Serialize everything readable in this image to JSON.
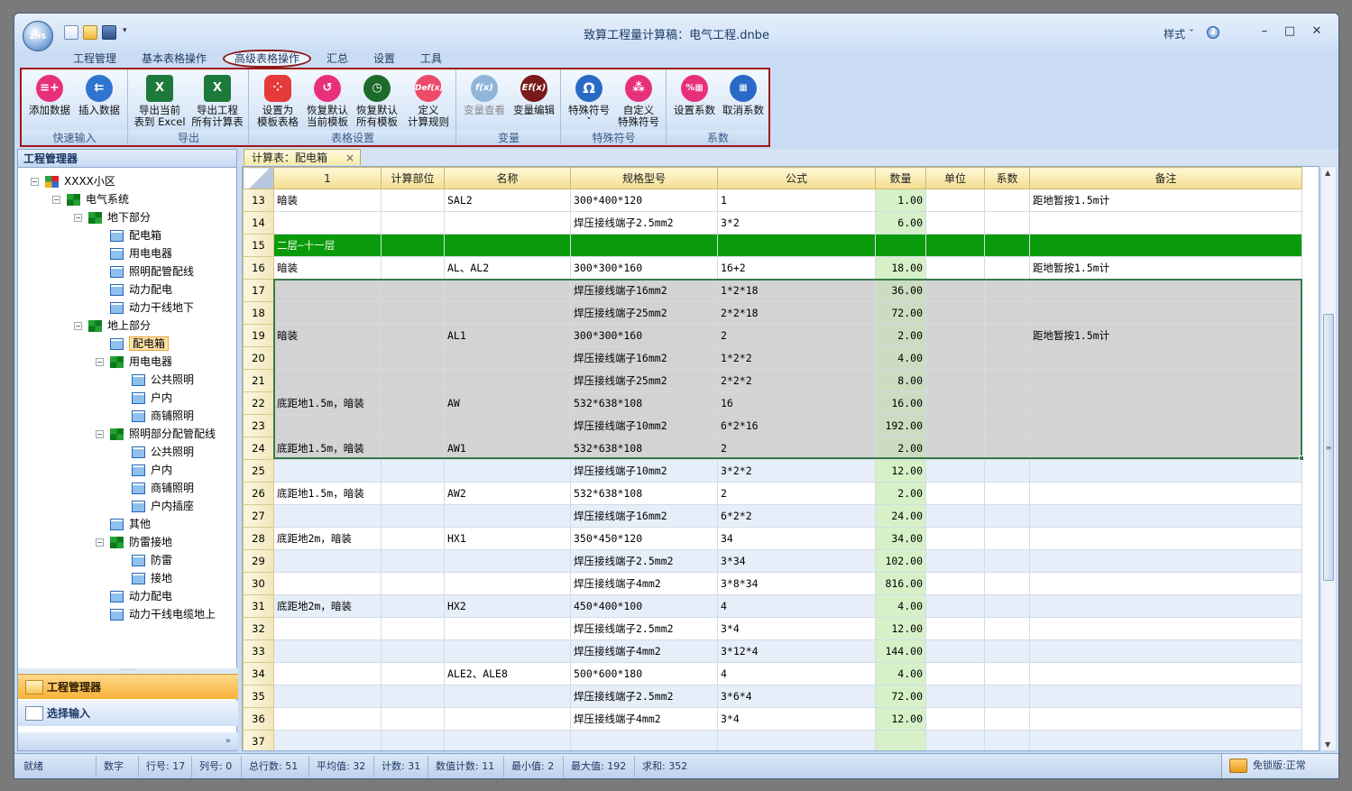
{
  "window": {
    "logo_text": "ZHS",
    "title": "致算工程量计算稿：电气工程.dnbe",
    "style_menu": "样式 ˇ",
    "help_icon": "help-icon",
    "min_glyph": "–",
    "max_glyph": "□",
    "close_glyph": "✕"
  },
  "tabs": [
    "工程管理",
    "基本表格操作",
    "高级表格操作",
    "汇总",
    "设置",
    "工具"
  ],
  "active_tab": "高级表格操作",
  "ribbon": {
    "groups": [
      {
        "label": "快速输入",
        "buttons": [
          {
            "label": "添加数据",
            "icon": "add-data-icon",
            "color": "#e8307a"
          },
          {
            "label": "插入数据",
            "icon": "insert-data-icon",
            "color": "#2f74d0"
          }
        ]
      },
      {
        "label": "导出",
        "buttons": [
          {
            "label": "导出当前\n表到 Excel",
            "icon": "excel-icon",
            "color": "#1d7a3a"
          },
          {
            "label": "导出工程\n所有计算表",
            "icon": "excel-icon",
            "color": "#1d7a3a"
          }
        ]
      },
      {
        "label": "表格设置",
        "buttons": [
          {
            "label": "设置为\n模板表格",
            "icon": "template-icon",
            "color": "#e63a3a"
          },
          {
            "label": "恢复默认\n当前模板",
            "icon": "restore-icon",
            "color": "#e8307a"
          },
          {
            "label": "恢复默认\n所有模板",
            "icon": "restore-all-icon",
            "color": "#1d6a2a"
          },
          {
            "label": "定义\n计算规则",
            "icon": "def-fx-icon",
            "color": "#ee4a6a"
          }
        ]
      },
      {
        "label": "变量",
        "buttons": [
          {
            "label": "变量查看",
            "icon": "fx-view-icon",
            "color": "#8fb6d8",
            "disabled": true
          },
          {
            "label": "变量编辑",
            "icon": "efx-edit-icon",
            "color": "#7a1a1a"
          }
        ]
      },
      {
        "label": "特殊符号",
        "buttons": [
          {
            "label": "特殊符号\nˇ",
            "icon": "omega-icon",
            "color": "#2a6ac6"
          },
          {
            "label": "自定义\n特殊符号",
            "icon": "custom-symbol-icon",
            "color": "#e8307a"
          }
        ]
      },
      {
        "label": "系数",
        "buttons": [
          {
            "label": "设置系数",
            "icon": "coef-set-icon",
            "color": "#e8307a"
          },
          {
            "label": "取消系数",
            "icon": "coef-cancel-icon",
            "color": "#2a6ac6"
          }
        ]
      }
    ]
  },
  "left_panel": {
    "header": "工程管理器",
    "tree": [
      {
        "label": "XXXX小区",
        "level": 0,
        "icon": "project-icon",
        "expand": "−"
      },
      {
        "label": "电气系统",
        "level": 1,
        "icon": "folder-green-icon",
        "expand": "−"
      },
      {
        "label": "地下部分",
        "level": 2,
        "icon": "folder-green-icon",
        "expand": "−"
      },
      {
        "label": "配电箱",
        "level": 3,
        "icon": "table-icon"
      },
      {
        "label": "用电电器",
        "level": 3,
        "icon": "table-icon"
      },
      {
        "label": "照明配管配线",
        "level": 3,
        "icon": "table-icon"
      },
      {
        "label": "动力配电",
        "level": 3,
        "icon": "table-icon"
      },
      {
        "label": "动力干线地下",
        "level": 3,
        "icon": "table-icon"
      },
      {
        "label": "地上部分",
        "level": 2,
        "icon": "folder-green-icon",
        "expand": "−"
      },
      {
        "label": "配电箱",
        "level": 3,
        "icon": "table-icon",
        "selected": true
      },
      {
        "label": "用电电器",
        "level": 3,
        "icon": "folder-green-icon",
        "expand": "−"
      },
      {
        "label": "公共照明",
        "level": 4,
        "icon": "table-icon"
      },
      {
        "label": "户内",
        "level": 4,
        "icon": "table-icon"
      },
      {
        "label": "商铺照明",
        "level": 4,
        "icon": "table-icon"
      },
      {
        "label": "照明部分配管配线",
        "level": 3,
        "icon": "folder-green-icon",
        "expand": "−"
      },
      {
        "label": "公共照明",
        "level": 4,
        "icon": "table-icon"
      },
      {
        "label": "户内",
        "level": 4,
        "icon": "table-icon"
      },
      {
        "label": "商铺照明",
        "level": 4,
        "icon": "table-icon"
      },
      {
        "label": "户内插座",
        "level": 4,
        "icon": "table-icon"
      },
      {
        "label": "其他",
        "level": 3,
        "icon": "table-icon"
      },
      {
        "label": "防雷接地",
        "level": 3,
        "icon": "folder-green-icon",
        "expand": "−"
      },
      {
        "label": "防雷",
        "level": 4,
        "icon": "table-icon"
      },
      {
        "label": "接地",
        "level": 4,
        "icon": "table-icon"
      },
      {
        "label": "动力配电",
        "level": 3,
        "icon": "table-icon"
      },
      {
        "label": "动力干线电缆地上",
        "level": 3,
        "icon": "table-icon"
      }
    ],
    "nav_items": [
      {
        "label": "工程管理器",
        "active": true
      },
      {
        "label": "选择输入",
        "active": false
      }
    ],
    "footer_glyph": "»"
  },
  "doc_tab": {
    "label": "计算表：配电箱",
    "close": "×"
  },
  "grid": {
    "columns": [
      "",
      "1",
      "计算部位",
      "名称",
      "规格型号",
      "公式",
      "数量",
      "单位",
      "系数",
      "备注"
    ],
    "rows": [
      {
        "n": "13",
        "c1": "暗装",
        "part": "",
        "name": "SAL2",
        "spec": "300*400*120",
        "formula": "1",
        "qty": "1.00",
        "unit": "",
        "coef": "",
        "note": "距地暂按1.5m计"
      },
      {
        "n": "14",
        "c1": "",
        "part": "",
        "name": "",
        "spec": "焊压接线端子2.5mm2",
        "formula": "3*2",
        "qty": "6.00",
        "unit": "",
        "coef": "",
        "note": ""
      },
      {
        "n": "15",
        "c1": "二层~十一层",
        "part": "",
        "name": "",
        "spec": "",
        "formula": "",
        "qty": "",
        "unit": "",
        "coef": "",
        "note": "",
        "style": "hl"
      },
      {
        "n": "16",
        "c1": "暗装",
        "part": "",
        "name": "AL、AL2",
        "spec": "300*300*160",
        "formula": "16+2",
        "qty": "18.00",
        "unit": "",
        "coef": "",
        "note": "距地暂按1.5m计"
      },
      {
        "n": "17",
        "c1": "",
        "part": "",
        "name": "",
        "spec": "焊压接线端子16mm2",
        "formula": "1*2*18",
        "qty": "36.00",
        "unit": "",
        "coef": "",
        "note": "",
        "style": "sel"
      },
      {
        "n": "18",
        "c1": "",
        "part": "",
        "name": "",
        "spec": "焊压接线端子25mm2",
        "formula": "2*2*18",
        "qty": "72.00",
        "unit": "",
        "coef": "",
        "note": "",
        "style": "sel"
      },
      {
        "n": "19",
        "c1": "暗装",
        "part": "",
        "name": "AL1",
        "spec": "300*300*160",
        "formula": "2",
        "qty": "2.00",
        "unit": "",
        "coef": "",
        "note": "距地暂按1.5m计",
        "style": "sel"
      },
      {
        "n": "20",
        "c1": "",
        "part": "",
        "name": "",
        "spec": "焊压接线端子16mm2",
        "formula": "1*2*2",
        "qty": "4.00",
        "unit": "",
        "coef": "",
        "note": "",
        "style": "sel"
      },
      {
        "n": "21",
        "c1": "",
        "part": "",
        "name": "",
        "spec": "焊压接线端子25mm2",
        "formula": "2*2*2",
        "qty": "8.00",
        "unit": "",
        "coef": "",
        "note": "",
        "style": "sel"
      },
      {
        "n": "22",
        "c1": "底距地1.5m，暗装",
        "part": "",
        "name": "AW",
        "spec": "532*638*108",
        "formula": "16",
        "qty": "16.00",
        "unit": "",
        "coef": "",
        "note": "",
        "style": "sel"
      },
      {
        "n": "23",
        "c1": "",
        "part": "",
        "name": "",
        "spec": "焊压接线端子10mm2",
        "formula": "6*2*16",
        "qty": "192.00",
        "unit": "",
        "coef": "",
        "note": "",
        "style": "sel"
      },
      {
        "n": "24",
        "c1": "底距地1.5m，暗装",
        "part": "",
        "name": "AW1",
        "spec": "532*638*108",
        "formula": "2",
        "qty": "2.00",
        "unit": "",
        "coef": "",
        "note": "",
        "style": "sel"
      },
      {
        "n": "25",
        "c1": "",
        "part": "",
        "name": "",
        "spec": "焊压接线端子10mm2",
        "formula": "3*2*2",
        "qty": "12.00",
        "unit": "",
        "coef": "",
        "note": "",
        "style": "alt"
      },
      {
        "n": "26",
        "c1": "底距地1.5m，暗装",
        "part": "",
        "name": "AW2",
        "spec": "532*638*108",
        "formula": "2",
        "qty": "2.00",
        "unit": "",
        "coef": "",
        "note": ""
      },
      {
        "n": "27",
        "c1": "",
        "part": "",
        "name": "",
        "spec": "焊压接线端子16mm2",
        "formula": "6*2*2",
        "qty": "24.00",
        "unit": "",
        "coef": "",
        "note": "",
        "style": "alt"
      },
      {
        "n": "28",
        "c1": "底距地2m，暗装",
        "part": "",
        "name": "HX1",
        "spec": "350*450*120",
        "formula": "34",
        "qty": "34.00",
        "unit": "",
        "coef": "",
        "note": ""
      },
      {
        "n": "29",
        "c1": "",
        "part": "",
        "name": "",
        "spec": "焊压接线端子2.5mm2",
        "formula": "3*34",
        "qty": "102.00",
        "unit": "",
        "coef": "",
        "note": "",
        "style": "alt"
      },
      {
        "n": "30",
        "c1": "",
        "part": "",
        "name": "",
        "spec": "焊压接线端子4mm2",
        "formula": "3*8*34",
        "qty": "816.00",
        "unit": "",
        "coef": "",
        "note": ""
      },
      {
        "n": "31",
        "c1": "底距地2m，暗装",
        "part": "",
        "name": "HX2",
        "spec": "450*400*100",
        "formula": "4",
        "qty": "4.00",
        "unit": "",
        "coef": "",
        "note": "",
        "style": "alt"
      },
      {
        "n": "32",
        "c1": "",
        "part": "",
        "name": "",
        "spec": "焊压接线端子2.5mm2",
        "formula": "3*4",
        "qty": "12.00",
        "unit": "",
        "coef": "",
        "note": ""
      },
      {
        "n": "33",
        "c1": "",
        "part": "",
        "name": "",
        "spec": "焊压接线端子4mm2",
        "formula": "3*12*4",
        "qty": "144.00",
        "unit": "",
        "coef": "",
        "note": "",
        "style": "alt"
      },
      {
        "n": "34",
        "c1": "",
        "part": "",
        "name": "ALE2、ALE8",
        "spec": "500*600*180",
        "formula": "4",
        "qty": "4.00",
        "unit": "",
        "coef": "",
        "note": ""
      },
      {
        "n": "35",
        "c1": "",
        "part": "",
        "name": "",
        "spec": "焊压接线端子2.5mm2",
        "formula": "3*6*4",
        "qty": "72.00",
        "unit": "",
        "coef": "",
        "note": "",
        "style": "alt"
      },
      {
        "n": "36",
        "c1": "",
        "part": "",
        "name": "",
        "spec": "焊压接线端子4mm2",
        "formula": "3*4",
        "qty": "12.00",
        "unit": "",
        "coef": "",
        "note": ""
      },
      {
        "n": "37",
        "c1": "",
        "part": "",
        "name": "",
        "spec": "",
        "formula": "",
        "qty": "",
        "unit": "",
        "coef": "",
        "note": "",
        "style": "alt"
      }
    ]
  },
  "status": {
    "ready": "就绪",
    "mode": "数字",
    "row": "行号: 17",
    "col": "列号: 0",
    "total_rows": "总行数: 51",
    "avg": "平均值: 32",
    "count": "计数: 31",
    "num_count": "数值计数: 11",
    "min": "最小值: 2",
    "max": "最大值: 192",
    "sum": "求和: 352",
    "license": "免锁版:正常"
  }
}
